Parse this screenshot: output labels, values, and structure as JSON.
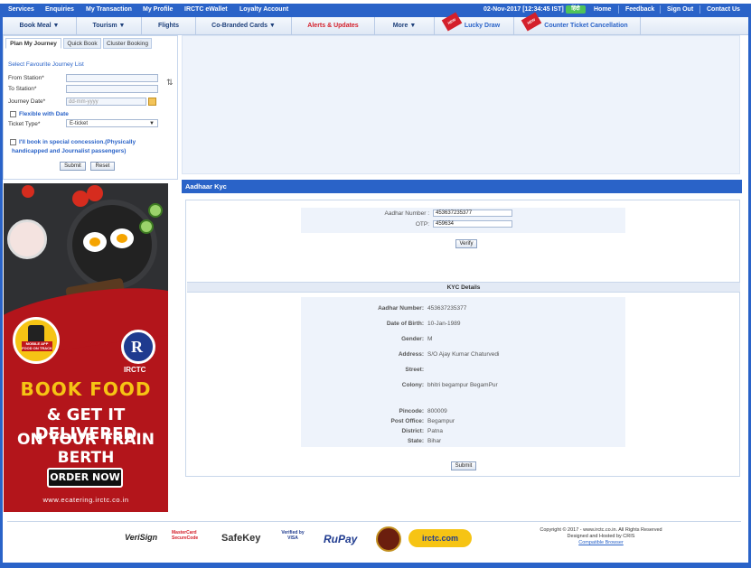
{
  "topnav": {
    "items": [
      "Services",
      "Enquiries",
      "My Transaction",
      "My Profile",
      "IRCTC eWallet",
      "Loyalty Account"
    ],
    "datetime": "02-Nov-2017 [12:34:45 IST]",
    "right_items": [
      "Home",
      "Feedback",
      "Sign Out",
      "Contact Us"
    ]
  },
  "menu": {
    "items": [
      "Book Meal ▼",
      "Tourism ▼",
      "Flights",
      "Co-Branded Cards ▼",
      "Alerts & Updates",
      "More ▼",
      "Lucky Draw",
      "Counter Ticket Cancellation"
    ],
    "new_tag": "NEW"
  },
  "left": {
    "tabs": [
      "Plan My Journey",
      "Quick Book",
      "Cluster Booking"
    ],
    "favourite_link": "Select Favourite Journey List",
    "from_label": "From Station*",
    "to_label": "To Station*",
    "date_label": "Journey Date*",
    "date_placeholder": "dd-mm-yyyy",
    "flexible_label": "Flexible with Date",
    "ticket_type_label": "Ticket Type*",
    "ticket_type_value": "E-ticket",
    "concession_line1": "I'll book in special concession.(Physically",
    "concession_line2": "handicapped and Journalist passengers)",
    "submit": "Submit",
    "reset": "Reset"
  },
  "ad": {
    "badge_text": "MOBILE APP\nFOOD ON TRACK",
    "brand": "IRCTC",
    "headline1": "BOOK FOOD",
    "headline2": "& GET IT DELIVERED",
    "headline3": "ON YOUR TRAIN BERTH",
    "cta": "ORDER NOW",
    "url": "www.ecatering.irctc.co.in"
  },
  "kyc": {
    "header": "Aadhaar Kyc",
    "aadhar_label": "Aadhar Number :",
    "aadhar_value": "453637235377",
    "otp_label": "OTP:",
    "otp_value": "459634",
    "verify": "Verify",
    "details_title": "KYC Details",
    "details": [
      {
        "label": "Aadhar Number:",
        "value": "453637235377"
      },
      {
        "label": "Date of Birth:",
        "value": "10-Jan-1989"
      },
      {
        "label": "Gender:",
        "value": "M"
      },
      {
        "label": "Address:",
        "value": "S/O Ajay Kumar Chaturvedi"
      },
      {
        "label": "Street:",
        "value": ""
      },
      {
        "label": "Colony:",
        "value": "bhitri begampur BegamPur"
      },
      {
        "label": "Pincode:",
        "value": "800009"
      },
      {
        "label": "Post Office:",
        "value": "Begampur"
      },
      {
        "label": "District:",
        "value": "Patna"
      },
      {
        "label": "State:",
        "value": "Bihar"
      }
    ],
    "submit": "Submit"
  },
  "footer": {
    "logos": [
      "VeriSign",
      "MasterCard SecureCode",
      "SafeKey",
      "Verified by VISA",
      "RuPay",
      "irctc.com"
    ],
    "copyright": "Copyright © 2017 - www.irctc.co.in. All Rights Reserved",
    "hosted": "Designed and Hosted by CRIS",
    "compatible": "Compatible Browser"
  },
  "colors": {
    "brand_blue": "#2a63c8",
    "alert_red": "#d4202b",
    "ad_red": "#b3151b"
  }
}
